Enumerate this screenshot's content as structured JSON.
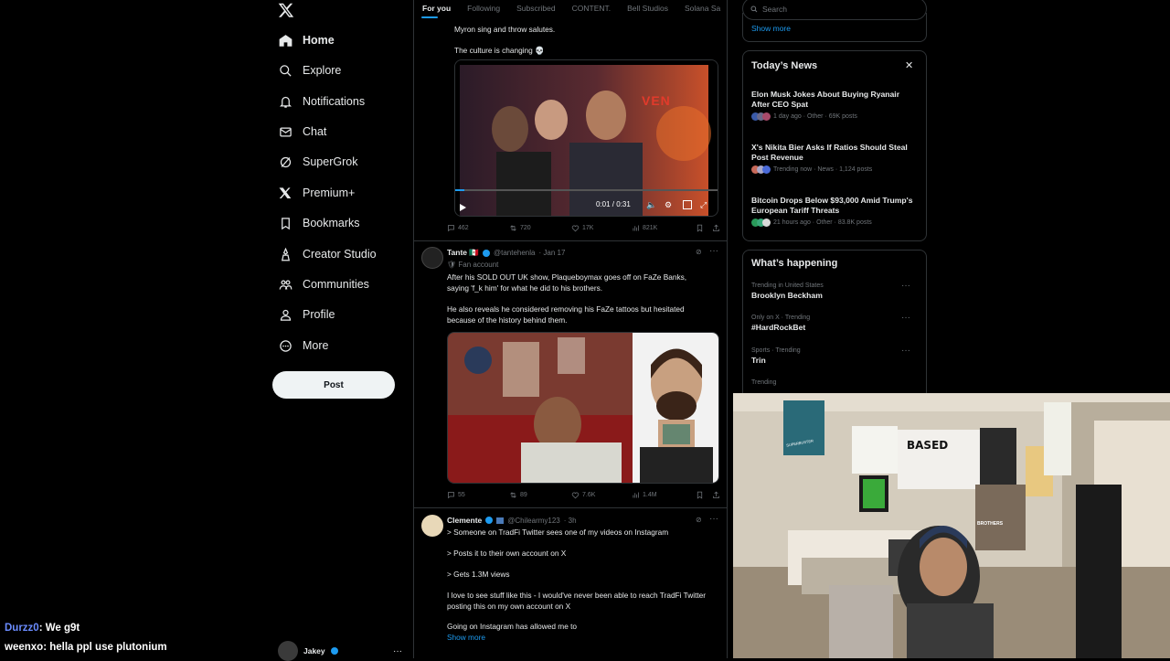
{
  "nav": {
    "items": [
      {
        "label": "Home",
        "icon": "home-icon",
        "active": true
      },
      {
        "label": "Explore",
        "icon": "search-icon"
      },
      {
        "label": "Notifications",
        "icon": "bell-icon"
      },
      {
        "label": "Chat",
        "icon": "mail-icon"
      },
      {
        "label": "SuperGrok",
        "icon": "grok-icon"
      },
      {
        "label": "Premium+",
        "icon": "x-icon"
      },
      {
        "label": "Bookmarks",
        "icon": "bookmark-icon"
      },
      {
        "label": "Creator Studio",
        "icon": "creator-studio-icon"
      },
      {
        "label": "Communities",
        "icon": "communities-icon"
      },
      {
        "label": "Profile",
        "icon": "person-icon"
      },
      {
        "label": "More",
        "icon": "more-circle-icon"
      }
    ],
    "post_label": "Post",
    "account_name": "Jakey"
  },
  "tabs": [
    "For you",
    "Following",
    "Subscribed",
    "CONTENT.",
    "Bell Studios",
    "Solana Sa"
  ],
  "tweet1": {
    "text_line": "Myron sing and throw salutes.",
    "text2": "The culture is changing 💀",
    "video_time": "0:01 / 0:31",
    "video_banner": "VEN",
    "replies": "462",
    "reposts": "720",
    "likes": "17K",
    "views": "821K"
  },
  "tweet2": {
    "name": "Tante 🇲🇽",
    "handle": "@tantehenla",
    "date": "· Jan 17",
    "tag": "🛡 Fan account",
    "text1": "After his SOLD OUT UK show, Plaqueboymax goes off on FaZe Banks, saying 'f_k him' for what he did to his brothers.",
    "text2": "He also reveals he considered removing his FaZe tattoos but hesitated because of the history behind them.",
    "replies": "55",
    "reposts": "89",
    "likes": "7.6K",
    "views": "1.4M"
  },
  "tweet3": {
    "name": "Clemente",
    "handle": "@Chilearmy123",
    "date": "· 3h",
    "lines": [
      "> Someone on TradFi Twitter sees one of my videos on Instagram",
      "> Posts it to their own account on X",
      "> Gets 1.3M views",
      "I love to see stuff like this - I would've never been able to reach TradFi Twitter posting this on my own account on X",
      "Going on Instagram has allowed me to"
    ],
    "show_more": "Show more"
  },
  "right": {
    "search_placeholder": "Search",
    "show_more": "Show more",
    "news_title": "Today’s News",
    "news": [
      {
        "title": "Elon Musk Jokes About Buying Ryanair After CEO Spat",
        "meta": "1 day ago · Other · 69K posts"
      },
      {
        "title": "X's Nikita Bier Asks If Ratios Should Steal Post Revenue",
        "meta": "Trending now · News · 1,124 posts"
      },
      {
        "title": "Bitcoin Drops Below $93,000 Amid Trump's European Tariff Threats",
        "meta": "21 hours ago · Other · 83.8K posts"
      }
    ],
    "happening_title": "What’s happening",
    "trends": [
      {
        "context": "Trending in United States",
        "title": "Brooklyn Beckham"
      },
      {
        "context": "Only on X · Trending",
        "title": "#HardRockBet"
      },
      {
        "context": "Sports · Trending",
        "title": "Trin"
      },
      {
        "context": "Trending",
        "title": ""
      }
    ]
  },
  "webcam": {
    "poster_text": "BASED",
    "shirt_text": "BROTHERS",
    "small_poster_text": "SUPERBUSTER"
  },
  "chat": [
    {
      "user": "Durzz0",
      "user_color": "#6b8cff",
      "message": ": We g9t"
    },
    {
      "user": "weenxo",
      "user_color": "#e7e9ea",
      "message": ": hella ppl use plutonium"
    }
  ],
  "colors": {
    "accent": "#1d9bf0",
    "bg": "#000000",
    "border": "#2f3336",
    "muted": "#71767b"
  }
}
